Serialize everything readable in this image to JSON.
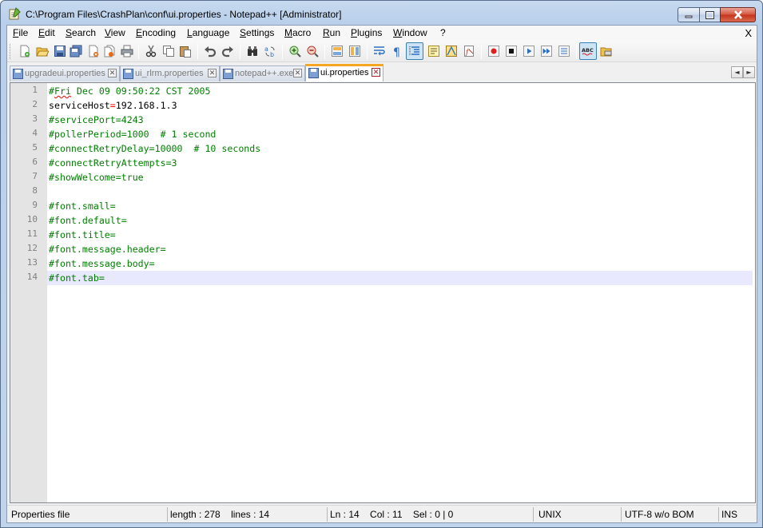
{
  "window": {
    "title": "C:\\Program Files\\CrashPlan\\conf\\ui.properties - Notepad++ [Administrator]",
    "accent": "#f6a623"
  },
  "menu": {
    "items": [
      "File",
      "Edit",
      "Search",
      "View",
      "Encoding",
      "Language",
      "Settings",
      "Macro",
      "Run",
      "Plugins",
      "Window",
      "?"
    ],
    "close_label": "X"
  },
  "toolbar": {
    "buttons": [
      "new-file-icon",
      "open-file-icon",
      "save-icon",
      "save-all-icon",
      "close-icon",
      "close-all-icon",
      "print-icon",
      "cut-icon",
      "copy-icon",
      "paste-icon",
      "undo-icon",
      "redo-icon",
      "find-icon",
      "replace-icon",
      "zoom-in-icon",
      "zoom-out-icon",
      "sync-vertical-icon",
      "sync-horizontal-icon",
      "word-wrap-icon",
      "show-all-chars-icon",
      "indent-guide-icon",
      "user-defined-language-icon",
      "doc-map-icon",
      "function-list-icon",
      "record-macro-icon",
      "stop-macro-icon",
      "play-macro-icon",
      "run-macro-multiple-icon",
      "save-macro-icon",
      "spell-check-icon",
      "plugin-folder-icon"
    ]
  },
  "tabs": [
    {
      "label": "upgradeui.properties",
      "active": false
    },
    {
      "label": "ui_rlrm.properties",
      "active": false
    },
    {
      "label": "notepad++.exe",
      "active": false
    },
    {
      "label": "ui.properties",
      "active": true
    }
  ],
  "tab_arrows": {
    "left": "◄",
    "right": "►"
  },
  "editor": {
    "lines": [
      {
        "n": "1",
        "parts": [
          {
            "t": "#",
            "c": "comment"
          },
          {
            "t": "Fri",
            "c": "comment squiggle"
          },
          {
            "t": " Dec 09 09:50:22 CST 2005",
            "c": "comment"
          }
        ]
      },
      {
        "n": "2",
        "parts": [
          {
            "t": "serviceHost",
            "c": "key"
          },
          {
            "t": "=",
            "c": "eq"
          },
          {
            "t": "192.168.1.3",
            "c": "val"
          }
        ]
      },
      {
        "n": "3",
        "parts": [
          {
            "t": "#servicePort=4243",
            "c": "comment"
          }
        ]
      },
      {
        "n": "4",
        "parts": [
          {
            "t": "#pollerPeriod=1000  # 1 second",
            "c": "comment"
          }
        ]
      },
      {
        "n": "5",
        "parts": [
          {
            "t": "#connectRetryDelay=10000  # 10 seconds",
            "c": "comment"
          }
        ]
      },
      {
        "n": "6",
        "parts": [
          {
            "t": "#connectRetryAttempts=3",
            "c": "comment"
          }
        ]
      },
      {
        "n": "7",
        "parts": [
          {
            "t": "#showWelcome=true",
            "c": "comment"
          }
        ]
      },
      {
        "n": "8",
        "parts": []
      },
      {
        "n": "9",
        "parts": [
          {
            "t": "#font.small=",
            "c": "comment"
          }
        ]
      },
      {
        "n": "10",
        "parts": [
          {
            "t": "#font.default=",
            "c": "comment"
          }
        ]
      },
      {
        "n": "11",
        "parts": [
          {
            "t": "#font.title=",
            "c": "comment"
          }
        ]
      },
      {
        "n": "12",
        "parts": [
          {
            "t": "#font.message.header=",
            "c": "comment"
          }
        ]
      },
      {
        "n": "13",
        "parts": [
          {
            "t": "#font.message.body=",
            "c": "comment"
          }
        ]
      },
      {
        "n": "14",
        "parts": [
          {
            "t": "#font.tab=",
            "c": "comment"
          }
        ]
      }
    ],
    "current_line": "14",
    "colors": {
      "comment": "#008000",
      "key": "#000000",
      "operator": "#ff0000",
      "current_line_bg": "#e8e8ff",
      "gutter_bg": "#e4e4e4"
    }
  },
  "status": {
    "file_type": "Properties file",
    "length": "length : 278",
    "lines": "lines : 14",
    "ln": "Ln : 14",
    "col": "Col : 11",
    "sel": "Sel : 0 | 0",
    "eol": "UNIX",
    "encoding": "UTF-8 w/o BOM",
    "mode": "INS"
  }
}
